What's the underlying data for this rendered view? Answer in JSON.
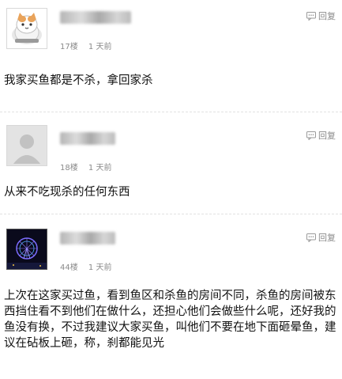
{
  "reply_label": "回复",
  "posts": [
    {
      "floor": "17楼",
      "time": "1 天前",
      "content": "我家买鱼都是不杀，拿回家杀"
    },
    {
      "floor": "18楼",
      "time": "1 天前",
      "content": "从来不吃现杀的任何东西"
    },
    {
      "floor": "44楼",
      "time": "1 天前",
      "content": "上次在这家买过鱼，看到鱼区和杀鱼的房间不同，杀鱼的房间被东西挡住看不到他们在做什么，还担心他们会做些什么呢，还好我的鱼没有换，不过我建议大家买鱼，叫他们不要在地下面砸晕鱼，建议在砧板上砸，称，刹都能见光"
    }
  ]
}
